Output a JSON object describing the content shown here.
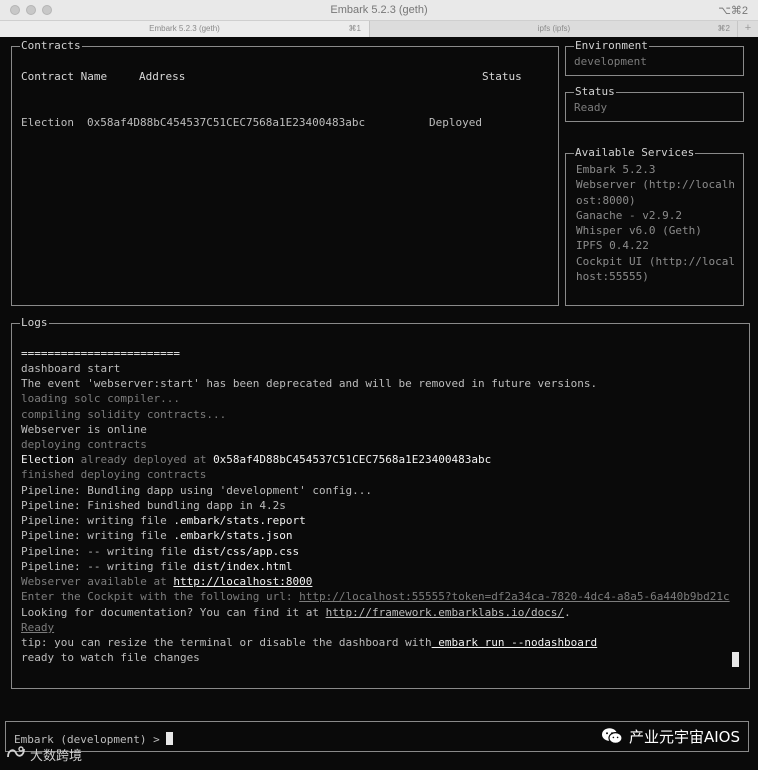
{
  "window": {
    "title": "Embark 5.2.3 (geth)",
    "shortcut": "⌥⌘2"
  },
  "tabs": [
    {
      "label": "Embark 5.2.3 (geth)",
      "key": "⌘1"
    },
    {
      "label": "ipfs (ipfs)",
      "key": "⌘2"
    }
  ],
  "tab_add": "+",
  "contracts": {
    "title": "Contracts",
    "headers": {
      "name": "Contract Name",
      "address": "Address",
      "status": "Status"
    },
    "rows": [
      {
        "name": "Election",
        "address": "0x58af4D88bC454537C51CEC7568a1E23400483abc",
        "status": "Deployed"
      }
    ]
  },
  "environment": {
    "title": "Environment",
    "value": "development"
  },
  "status": {
    "title": "Status",
    "value": "Ready"
  },
  "services": {
    "title": "Available Services",
    "lines": [
      "Embark 5.2.3",
      "Webserver (http://localh",
      "ost:8000)",
      "Ganache - v2.9.2",
      "Whisper v6.0 (Geth)",
      "IPFS 0.4.22",
      "Cockpit UI (http://local",
      "host:55555)"
    ]
  },
  "logs": {
    "title": "Logs",
    "separator": "========================",
    "l1": "dashboard start",
    "l2": "The event 'webserver:start' has been deprecated and will be removed in future versions.",
    "l3": "loading solc compiler...",
    "l4": "compiling solidity contracts...",
    "l5": "Webserver is online",
    "l6": "deploying contracts",
    "l7a": "Election",
    "l7b": " already deployed at ",
    "l7c": "0x58af4D88bC454537C51CEC7568a1E23400483abc",
    "l8": "finished deploying contracts",
    "l9": "Pipeline: Bundling dapp using 'development' config...",
    "l10": "Pipeline: Finished bundling dapp in 4.2s",
    "l11a": "Pipeline: writing file ",
    "l11b": ".embark/stats.report",
    "l12a": "Pipeline: writing file ",
    "l12b": ".embark/stats.json",
    "l13a": "Pipeline: -- writing file ",
    "l13b": "dist/css/app.css",
    "l14a": "Pipeline: -- writing file ",
    "l14b": "dist/index.html",
    "l15a": "Webserver available at ",
    "l15b": "http://localhost:8000",
    "l16a": "Enter the Cockpit with the following url: ",
    "l16b": "http://localhost:55555?token=df2a34ca-7820-4dc4-a8a5-6a440b9bd21c",
    "l17a": "Looking for documentation? You can find it at ",
    "l17b": "http://framework.embarklabs.io/docs/",
    "l17c": ".",
    "l18": "Ready",
    "l19a": "tip: you can resize the terminal or disable the dashboard with",
    "l19b": " embark run --nodashboard",
    "l20": "ready to watch file changes"
  },
  "prompt": "Embark (development) > ",
  "watermarks": {
    "right": "产业元宇宙AIOS",
    "left": "大数跨境"
  }
}
